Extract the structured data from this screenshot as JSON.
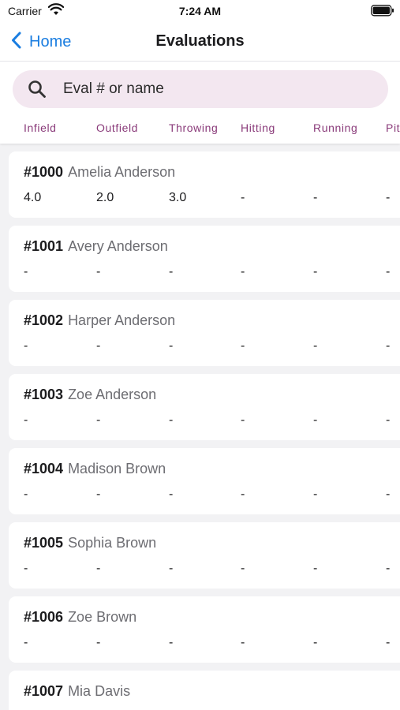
{
  "status_bar": {
    "carrier": "Carrier",
    "time": "7:24 AM",
    "icons": [
      "wifi-icon",
      "battery-icon"
    ]
  },
  "nav": {
    "back_label": "Home",
    "title": "Evaluations",
    "accent": "#1a7de0"
  },
  "search": {
    "placeholder": "Eval # or name",
    "background": "#f3e7f0"
  },
  "tabs": [
    "Infield",
    "Outfield",
    "Throwing",
    "Hitting",
    "Running",
    "Pit"
  ],
  "tab_color": "#8a3b7a",
  "evaluations": [
    {
      "num": "#1000",
      "name": "Amelia Anderson",
      "scores": [
        "4.0",
        "2.0",
        "3.0",
        "-",
        "-",
        "-"
      ]
    },
    {
      "num": "#1001",
      "name": "Avery Anderson",
      "scores": [
        "-",
        "-",
        "-",
        "-",
        "-",
        "-"
      ]
    },
    {
      "num": "#1002",
      "name": "Harper Anderson",
      "scores": [
        "-",
        "-",
        "-",
        "-",
        "-",
        "-"
      ]
    },
    {
      "num": "#1003",
      "name": "Zoe Anderson",
      "scores": [
        "-",
        "-",
        "-",
        "-",
        "-",
        "-"
      ]
    },
    {
      "num": "#1004",
      "name": "Madison Brown",
      "scores": [
        "-",
        "-",
        "-",
        "-",
        "-",
        "-"
      ]
    },
    {
      "num": "#1005",
      "name": "Sophia Brown",
      "scores": [
        "-",
        "-",
        "-",
        "-",
        "-",
        "-"
      ]
    },
    {
      "num": "#1006",
      "name": "Zoe Brown",
      "scores": [
        "-",
        "-",
        "-",
        "-",
        "-",
        "-"
      ]
    },
    {
      "num": "#1007",
      "name": "Mia Davis",
      "scores": []
    }
  ]
}
